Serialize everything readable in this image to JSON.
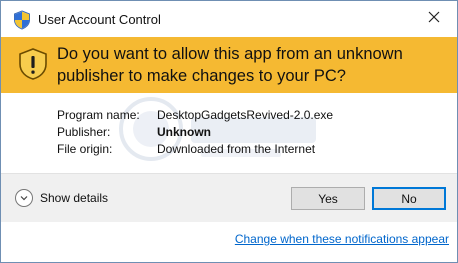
{
  "window": {
    "title": "User Account Control",
    "close_glyph": "✕"
  },
  "banner": {
    "question": "Do you want to allow this app from an unknown publisher to make changes to your PC?",
    "color": "#f5b932",
    "icon": "warning-shield-icon"
  },
  "details": {
    "program_name_label": "Program name:",
    "program_name_value": "DesktopGadgetsRevived-2.0.exe",
    "publisher_label": "Publisher:",
    "publisher_value": "Unknown",
    "file_origin_label": "File origin:",
    "file_origin_value": "Downloaded from the Internet"
  },
  "footer": {
    "show_details_label": "Show details",
    "yes_label": "Yes",
    "no_label": "No",
    "accent_color": "#0078d7"
  },
  "link": {
    "notifications_label": "Change when these notifications appear",
    "color": "#0066cc"
  }
}
